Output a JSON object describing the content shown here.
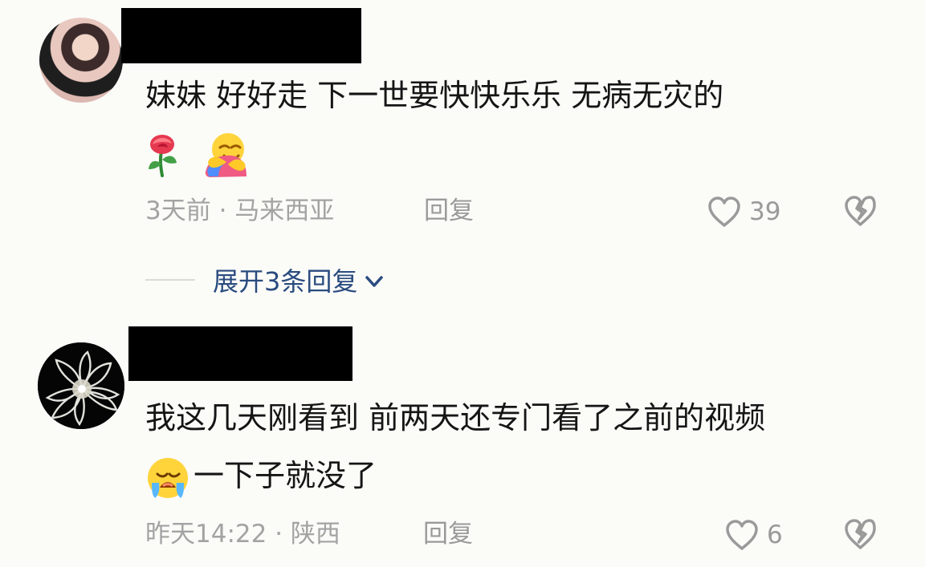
{
  "comments": [
    {
      "line1": "妹妹  好好走  下一世要快快乐乐 无病无灾的",
      "meta": "3天前 · 马来西亚",
      "reply_label": "回复",
      "like_count": "39"
    },
    {
      "line1": "我这几天刚看到 前两天还专门看了之前的视频",
      "line2": "一下子就没了",
      "meta": "昨天14:22 · 陕西",
      "reply_label": "回复",
      "like_count": "6"
    }
  ],
  "expand": {
    "label": "展开3条回复"
  },
  "icons": {
    "heart": "heart-outline-icon",
    "broken_heart": "broken-heart-icon",
    "expand": "chevron-down-icon",
    "rose": "rose-emoji",
    "hug": "hug-emoji",
    "cry": "loudly-crying-emoji"
  },
  "colors": {
    "background": "#fbfbf8",
    "text": "#151515",
    "muted": "#a3a3a3",
    "expand_link": "#294b7f",
    "redaction": "#000000"
  }
}
